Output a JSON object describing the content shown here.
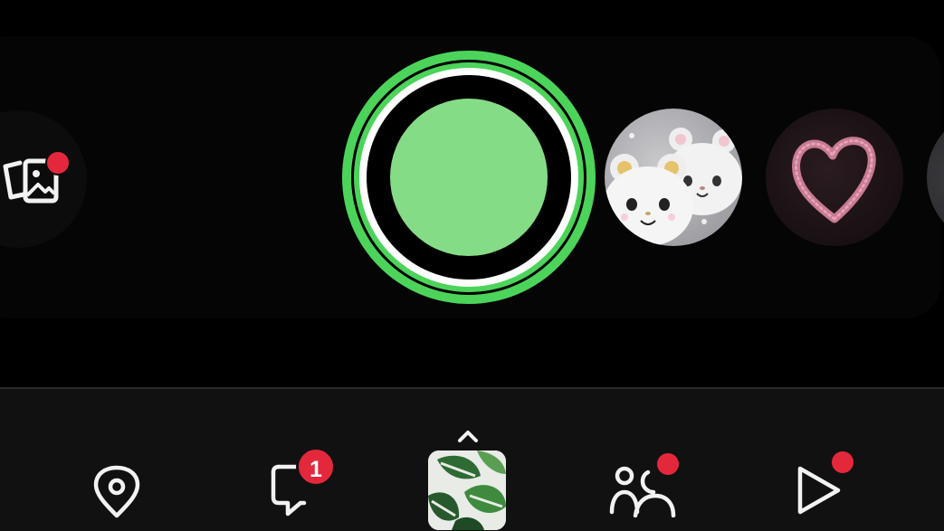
{
  "colors": {
    "background": "#000000",
    "nav_background": "#111111",
    "capture_ring": "#4cd45a",
    "capture_center": "#85dc86",
    "badge_red": "#e4283c",
    "icon_white": "#f2f2f2"
  },
  "carousel": {
    "memories_icon": "memories-icon",
    "memories_has_notification": true,
    "lenses": [
      {
        "name": "bears",
        "icon": "bear-lens-thumbnail"
      },
      {
        "name": "heart",
        "icon": "heart-lens-thumbnail"
      },
      {
        "name": "partial",
        "icon": "lens-thumbnail"
      }
    ]
  },
  "bottom_nav": {
    "items": [
      {
        "name": "map",
        "icon": "map-pin-icon"
      },
      {
        "name": "chat",
        "icon": "chat-icon",
        "badge": "1"
      },
      {
        "name": "camera",
        "icon": "camera-thumbnail",
        "caret_icon": "chevron-up-icon"
      },
      {
        "name": "stories",
        "icon": "friends-icon",
        "has_dot": true
      },
      {
        "name": "spotlight",
        "icon": "play-icon",
        "has_dot": true
      }
    ]
  }
}
